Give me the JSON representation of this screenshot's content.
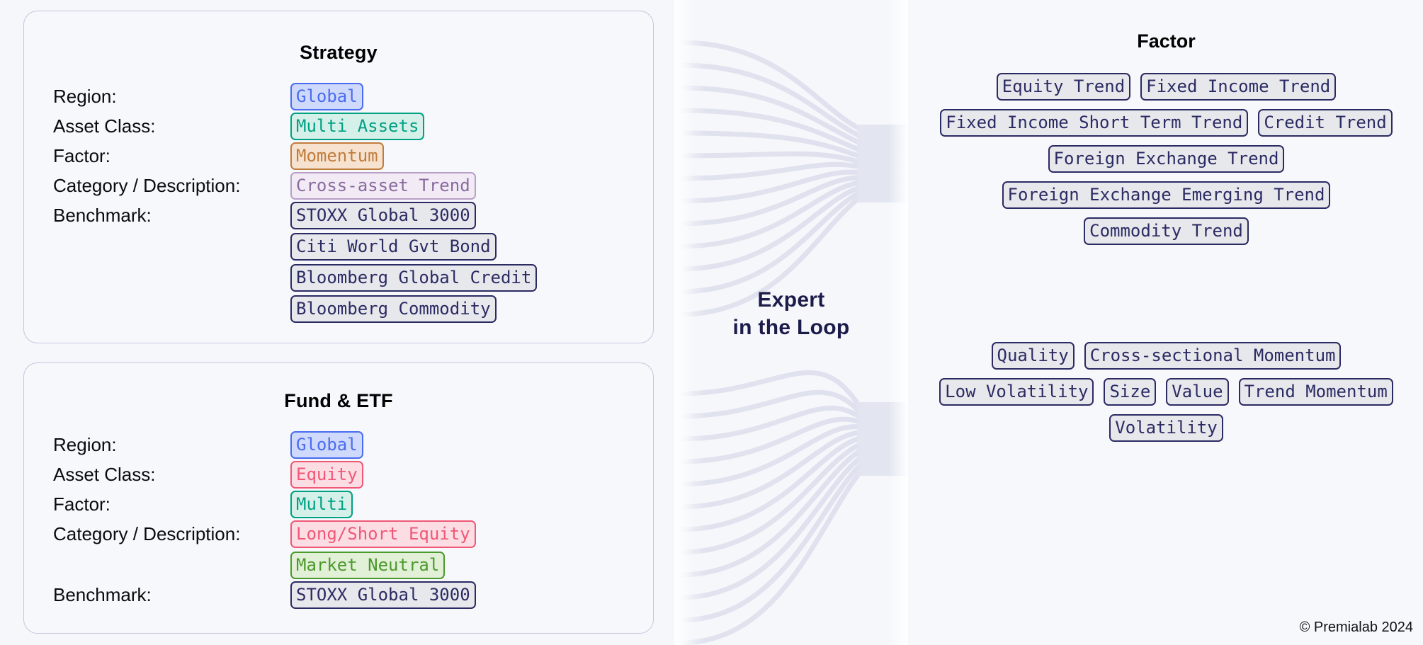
{
  "theme": {
    "page_bg": "#f6f7fb",
    "card_bg": "#f7f8fc",
    "card_border": "#c3c7de",
    "navy": "#2b2b63",
    "expert_text": "#1c1c4b"
  },
  "left": {
    "cards": [
      {
        "title": "Strategy",
        "rows": [
          {
            "label": "Region:",
            "values": [
              {
                "text": "Global",
                "color": "blue"
              }
            ]
          },
          {
            "label": "Asset Class:",
            "values": [
              {
                "text": "Multi Assets",
                "color": "teal"
              }
            ]
          },
          {
            "label": "Factor:",
            "values": [
              {
                "text": "Momentum",
                "color": "orange"
              }
            ]
          },
          {
            "label": "Category / Description:",
            "values": [
              {
                "text": "Cross-asset Trend",
                "color": "purple"
              }
            ]
          },
          {
            "label": "Benchmark:",
            "values": [
              {
                "text": "STOXX Global 3000",
                "color": "navy"
              },
              {
                "text": "Citi World Gvt Bond",
                "color": "navy"
              },
              {
                "text": "Bloomberg Global Credit",
                "color": "navy"
              },
              {
                "text": "Bloomberg Commodity",
                "color": "navy"
              }
            ]
          }
        ]
      },
      {
        "title": "Fund & ETF",
        "rows": [
          {
            "label": "Region:",
            "values": [
              {
                "text": "Global",
                "color": "blue"
              }
            ]
          },
          {
            "label": "Asset Class:",
            "values": [
              {
                "text": "Equity",
                "color": "pink"
              }
            ]
          },
          {
            "label": "Factor:",
            "values": [
              {
                "text": "Multi",
                "color": "teal"
              }
            ]
          },
          {
            "label": "Category / Description:",
            "values": [
              {
                "text": "Long/Short Equity",
                "color": "pink"
              },
              {
                "text": "Market Neutral",
                "color": "green"
              }
            ]
          },
          {
            "label": "Benchmark:",
            "values": [
              {
                "text": "STOXX Global 3000",
                "color": "navy"
              }
            ]
          }
        ]
      }
    ]
  },
  "middle": {
    "label_line1": "Expert",
    "label_line2": "in the Loop"
  },
  "right": {
    "title": "Factor",
    "trend_tags": [
      "Equity Trend",
      "Fixed Income Trend",
      "Fixed Income Short Term Trend",
      "Credit Trend",
      "Foreign Exchange Trend",
      "Foreign Exchange Emerging Trend",
      "Commodity Trend"
    ],
    "style_tags": [
      "Quality",
      "Cross-sectional Momentum",
      "Low Volatility",
      "Size",
      "Value",
      "Trend Momentum",
      "Volatility"
    ]
  },
  "footer": {
    "copyright": "© Premialab 2024"
  }
}
